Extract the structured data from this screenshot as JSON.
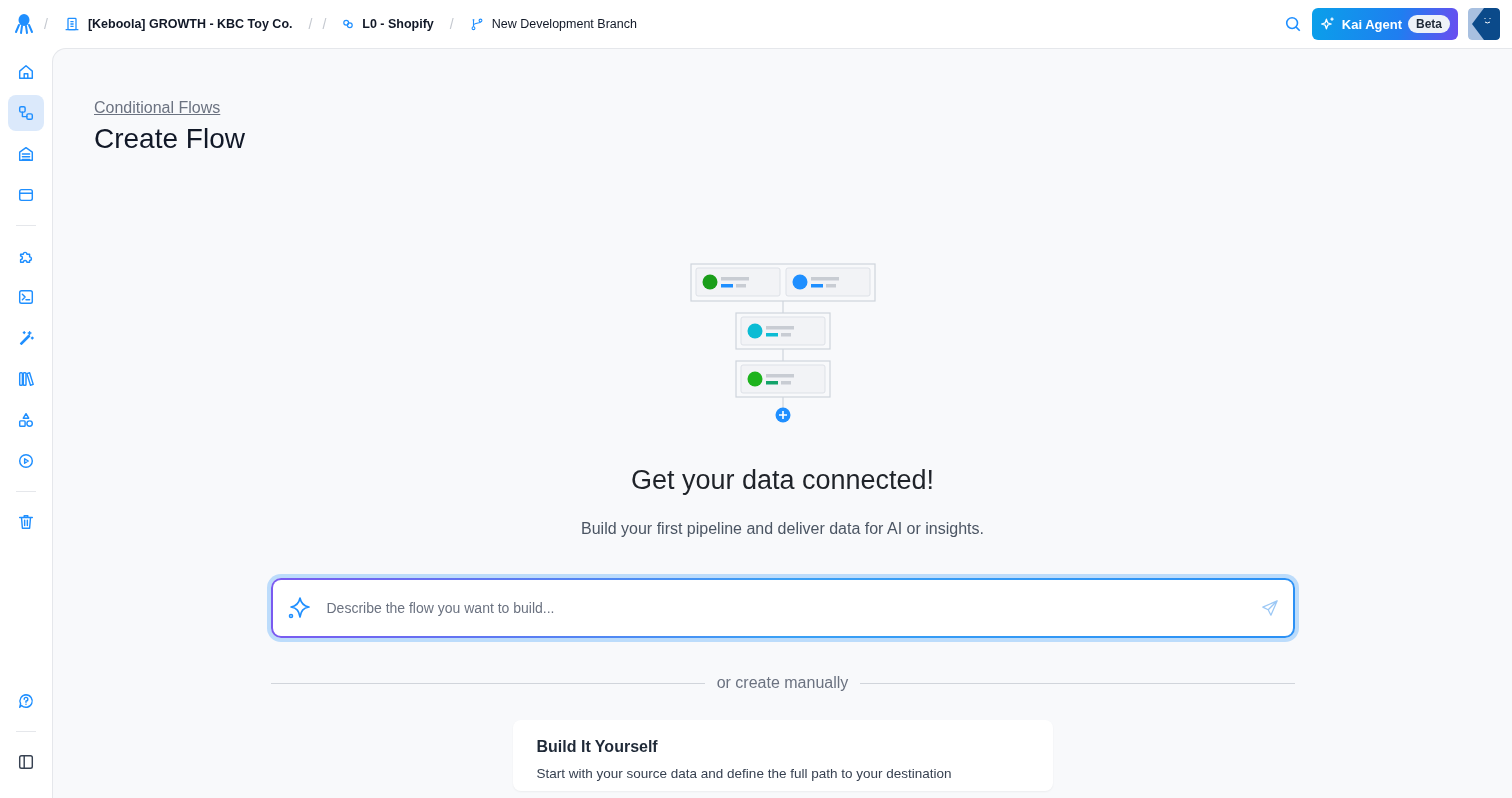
{
  "topbar": {
    "breadcrumbs": [
      {
        "separators": [
          "/"
        ],
        "text": "[Keboola] GROWTH - KBC Toy Co.",
        "kind": "project"
      },
      {
        "separators": [
          "/",
          "/"
        ],
        "text": "L0 - Shopify",
        "kind": "flow"
      },
      {
        "separators": [
          "/"
        ],
        "text": "New Development Branch",
        "kind": "branch"
      }
    ],
    "agent_button": {
      "label": "Kai Agent",
      "badge": "Beta"
    }
  },
  "sidebar": {
    "groups": [
      {
        "items": [
          {
            "selected": false
          },
          {
            "selected": true
          },
          {
            "selected": false
          },
          {
            "selected": false
          }
        ]
      },
      {
        "items": [
          {
            "selected": false
          },
          {
            "selected": false
          },
          {
            "selected": false
          },
          {
            "selected": false
          },
          {
            "selected": false
          },
          {
            "selected": false
          }
        ]
      },
      {
        "items": [
          {
            "selected": false
          }
        ]
      },
      {
        "items": [
          {
            "selected": false
          }
        ]
      },
      {
        "items": [
          {
            "selected": false
          }
        ]
      }
    ]
  },
  "page": {
    "breadcrumb": "Conditional Flows",
    "title": "Create Flow"
  },
  "empty_state": {
    "heading": "Get your data connected!",
    "subtitle": "Build your first pipeline and deliver data for AI or insights.",
    "prompt": {
      "placeholder": "Describe the flow you want to build..."
    },
    "divider": "or create manually",
    "card": {
      "title": "Build It Yourself",
      "text": "Start with your source data and define the full path to your destination"
    }
  }
}
